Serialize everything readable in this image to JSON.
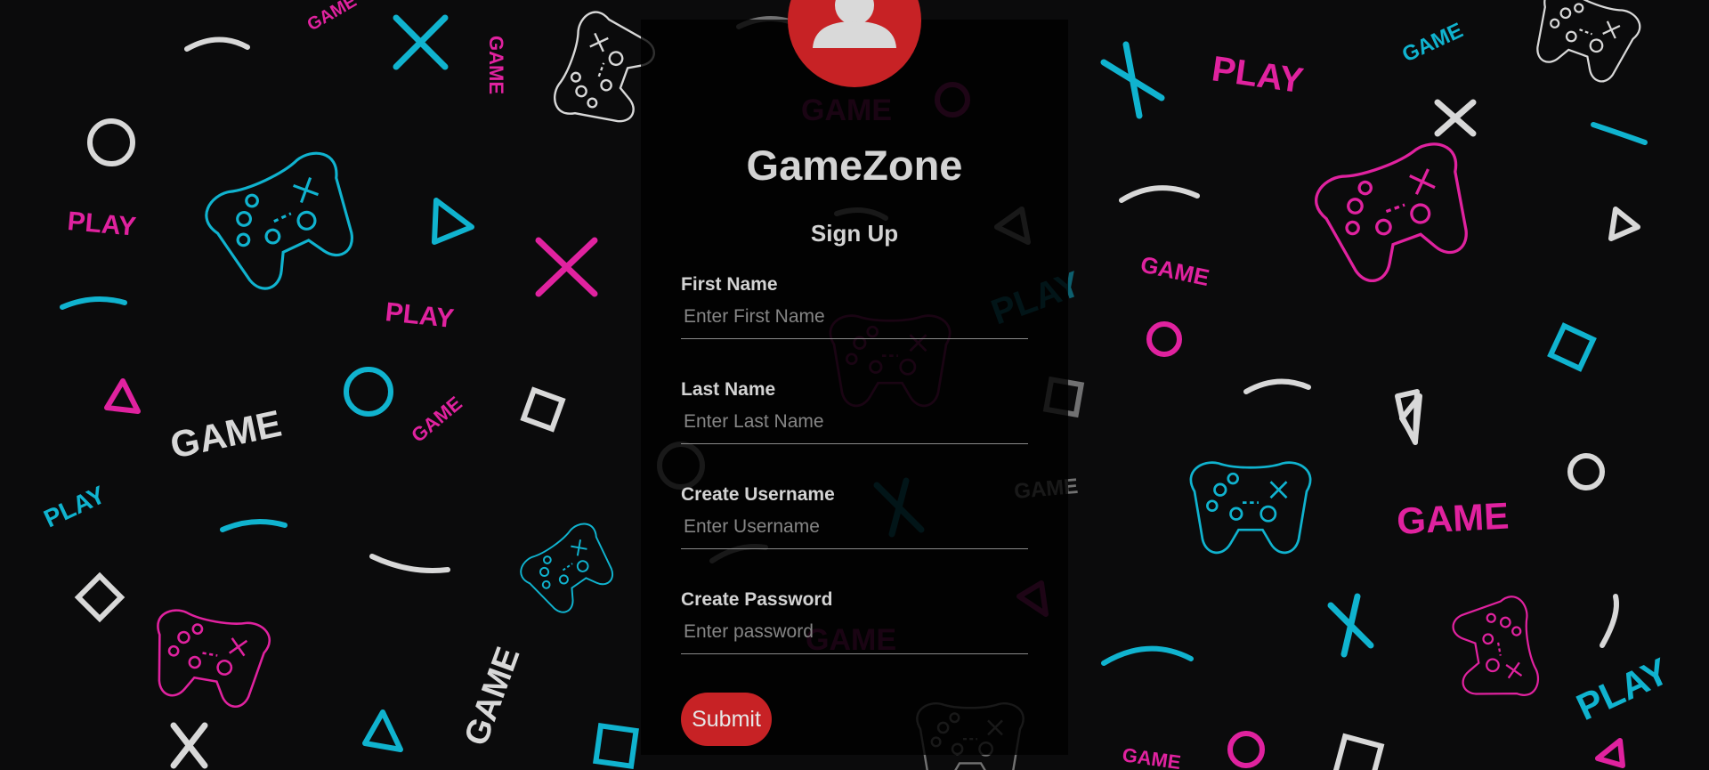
{
  "app": {
    "title": "GameZone",
    "subtitle": "Sign Up"
  },
  "form": {
    "fields": [
      {
        "label": "First Name",
        "placeholder": "Enter First Name",
        "value": ""
      },
      {
        "label": "Last Name",
        "placeholder": "Enter Last Name",
        "value": ""
      },
      {
        "label": "Create Username",
        "placeholder": "Enter Username",
        "value": ""
      },
      {
        "label": "Create Password",
        "placeholder": "Enter password",
        "value": ""
      }
    ],
    "submit_label": "Submit"
  },
  "icons": {
    "avatar": "user-avatar-icon",
    "background": "gamepad-pattern"
  },
  "background_pattern": {
    "words": [
      "GAME",
      "PLAY"
    ],
    "colors": {
      "cyan": "#10b3cf",
      "pink": "#e0229f",
      "white": "#d8d8d8",
      "base": "#0b0b0c"
    }
  },
  "theme": {
    "accent": "#c72225",
    "text": "#d3d3d3",
    "placeholder": "#858585"
  }
}
